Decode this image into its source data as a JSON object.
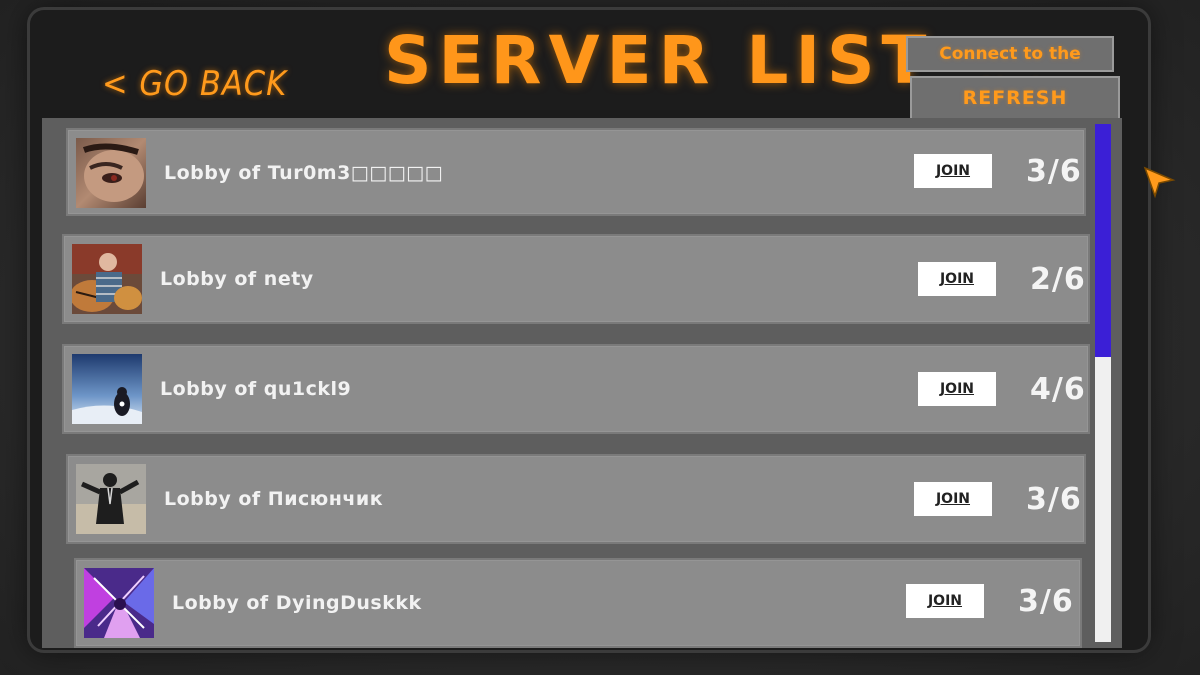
{
  "header": {
    "back_label": "< GO BACK",
    "title": "SERVER LIST",
    "connect_friend_label": "Connect to the friend",
    "refresh_label": "REFRESH LOBBIES"
  },
  "lobbies": [
    {
      "name": "Lobby of Tur0m3□□□□□",
      "join_label": "JOIN",
      "players": "3/6",
      "avatar_icon": "face-closeup-avatar"
    },
    {
      "name": "Lobby of nety",
      "join_label": "JOIN",
      "players": "2/6",
      "avatar_icon": "man-with-tiger-avatar"
    },
    {
      "name": "Lobby of qu1ckl9",
      "join_label": "JOIN",
      "players": "4/6",
      "avatar_icon": "blue-sky-figure-avatar"
    },
    {
      "name": "Lobby of Писюнчик",
      "join_label": "JOIN",
      "players": "3/6",
      "avatar_icon": "suited-man-avatar"
    },
    {
      "name": "Lobby of DyingDuskkk",
      "join_label": "JOIN",
      "players": "3/6",
      "avatar_icon": "purple-abstract-avatar"
    }
  ],
  "scrollbar": {
    "position_fraction": 0.0,
    "visible_fraction": 0.45
  },
  "colors": {
    "accent_orange": "#ff961a",
    "scroll_thumb": "#3b1fd6",
    "row_bg": "#8c8c8c"
  }
}
